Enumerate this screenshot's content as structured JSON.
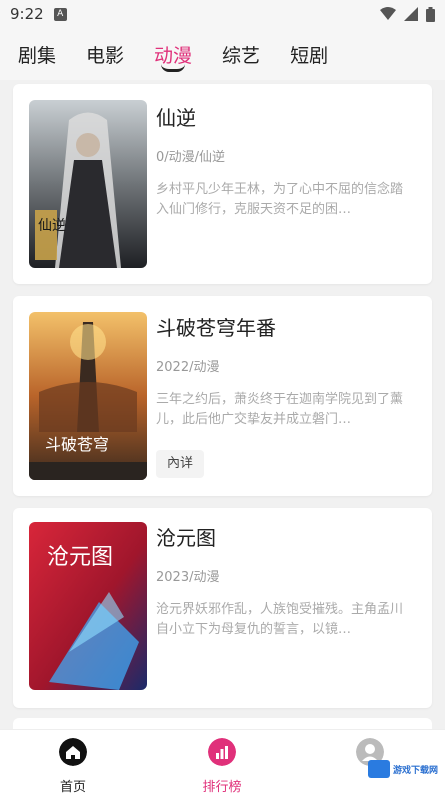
{
  "status_bar": {
    "time": "9:22",
    "notification_icon": "A"
  },
  "tabs": [
    {
      "label": "剧集"
    },
    {
      "label": "电影"
    },
    {
      "label": "动漫"
    },
    {
      "label": "综艺"
    },
    {
      "label": "短剧"
    }
  ],
  "active_tab": "动漫",
  "cards": [
    {
      "title": "仙逆",
      "meta": "0/动漫/仙逆",
      "description": "乡村平凡少年王林，为了心中不屈的信念踏入仙门修行，克服天资不足的困…",
      "poster_text": "仙逆"
    },
    {
      "title": "斗破苍穹年番",
      "meta": "2022/动漫",
      "description": "三年之约后，萧炎终于在迦南学院见到了薰儿，此后他广交挚友并成立磐门…",
      "poster_text": "斗破苍穹",
      "button": "內详"
    },
    {
      "title": "沧元图",
      "meta": "2023/动漫",
      "description": "沧元界妖邪作乱，人族饱受摧残。主角孟川自小立下为母复仇的誓言，以镜…",
      "poster_text": "沧元图"
    }
  ],
  "bottom_nav": [
    {
      "label": "首页",
      "icon": "home-icon"
    },
    {
      "label": "排行榜",
      "icon": "ranking-icon"
    },
    {
      "label": "",
      "icon": "user-icon"
    }
  ],
  "watermark": {
    "text": "游戏下载网"
  },
  "colors": {
    "accent": "#e0307a",
    "background": "#f1f1f1",
    "card": "#ffffff"
  }
}
